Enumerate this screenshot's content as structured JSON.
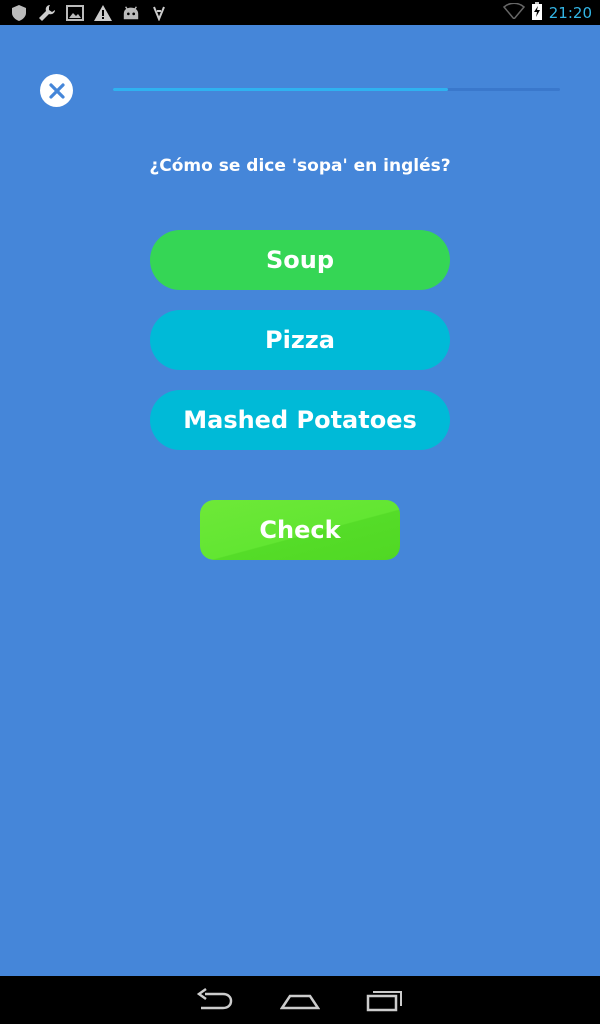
{
  "status_bar": {
    "time": "21:20",
    "left_icons": [
      "shield-icon",
      "wrench-icon",
      "image-icon",
      "warning-icon",
      "android-icon",
      "download-icon"
    ],
    "right_icons": [
      "wifi-icon",
      "battery-charging-icon"
    ]
  },
  "quiz": {
    "progress": 0.75,
    "question": "¿Cómo se dice 'sopa' en inglés?",
    "options": [
      {
        "label": "Soup",
        "color": "#35d655",
        "selected": true
      },
      {
        "label": "Pizza",
        "color": "#00bad7",
        "selected": false
      },
      {
        "label": "Mashed Potatoes",
        "color": "#00bad7",
        "selected": false
      }
    ],
    "check_label": "Check"
  },
  "colors": {
    "background": "#4586d9",
    "selected_option": "#35d655",
    "option": "#00bad7",
    "check_button": "#62e632",
    "progress_fill": "#2fb2f0"
  },
  "nav_bar": {
    "buttons": [
      "back-icon",
      "home-icon",
      "recent-apps-icon"
    ]
  }
}
